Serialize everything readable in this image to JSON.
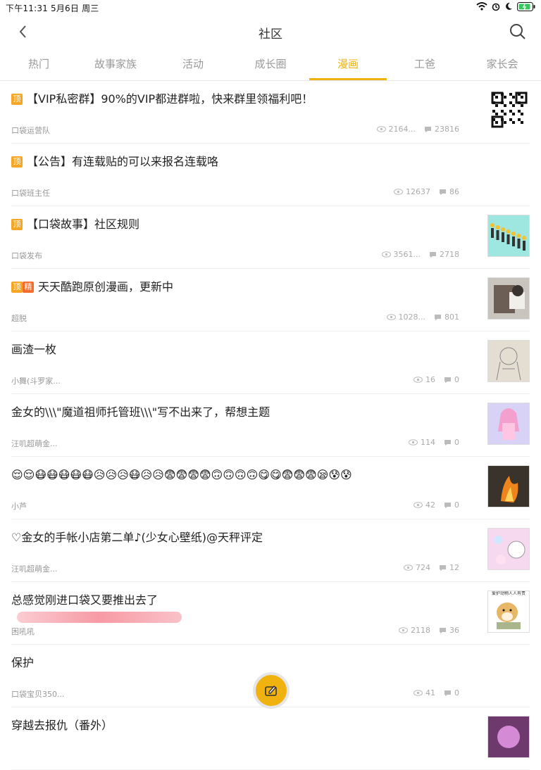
{
  "status": {
    "time_date": "下午11:31   5月6日 周三",
    "icons": [
      "wifi-icon",
      "alarm-icon",
      "moon-icon",
      "battery-icon"
    ]
  },
  "nav": {
    "title": "社区"
  },
  "tabs": [
    {
      "label": "热门"
    },
    {
      "label": "故事家族"
    },
    {
      "label": "活动"
    },
    {
      "label": "成长圈"
    },
    {
      "label": "漫画",
      "active": true
    },
    {
      "label": "工爸"
    },
    {
      "label": "家长会"
    }
  ],
  "posts": [
    {
      "top": "顶",
      "title": "【VIP私密群】90%的VIP都进群啦，快来群里领福利吧！",
      "author": "口袋运营队",
      "views": "2164...",
      "comments": "23816",
      "thumb": "qr-code"
    },
    {
      "top": "顶",
      "title": "【公告】有连载贴的可以来报名连载咯",
      "author": "口袋班主任",
      "views": "12637",
      "comments": "86"
    },
    {
      "top": "顶",
      "title": "【口袋故事】社区规则",
      "author": "口袋发布",
      "views": "3561...",
      "comments": "2718",
      "thumb": "figures"
    },
    {
      "top": "顶",
      "essence": "精",
      "title": "天天酷跑原创漫画，更新中",
      "author": "超脱",
      "views": "1028...",
      "comments": "801",
      "thumb": "photo"
    },
    {
      "title": "画渣一枚",
      "author": "小舞(斗罗家...",
      "views": "16",
      "comments": "0",
      "thumb": "sketch"
    },
    {
      "title": "金女的\\\\\\\"魔道祖师托管班\\\\\\\"写不出来了，帮想主题",
      "author": "汪叽超萌金...",
      "views": "114",
      "comments": "0",
      "thumb": "anime"
    },
    {
      "title": "😌😌😷😷😷😷😷😥😥😥😷😥😥😨😨😨😨🙃🙃🙃🙃😋😋😨😨😨😪😰😰",
      "author": "小芦",
      "views": "42",
      "comments": "0",
      "thumb": "fire"
    },
    {
      "title": "♡金女的手帐小店第二单♪(少女心壁纸)@天秤评定",
      "author": "汪叽超萌金...",
      "views": "724",
      "comments": "12",
      "thumb": "pastel"
    },
    {
      "title": "总感觉刚进口袋又要推出去了",
      "author": "困吼吼",
      "views": "2118",
      "comments": "36",
      "thumb": "doge",
      "thumb_caption": "爱护动物人人有责"
    },
    {
      "title": "保护",
      "author": "口袋宝贝350...",
      "views": "41",
      "comments": "0"
    },
    {
      "title": "穿越去报仇（番外）",
      "author": "",
      "views": "",
      "comments": "",
      "thumb": "purple"
    }
  ]
}
